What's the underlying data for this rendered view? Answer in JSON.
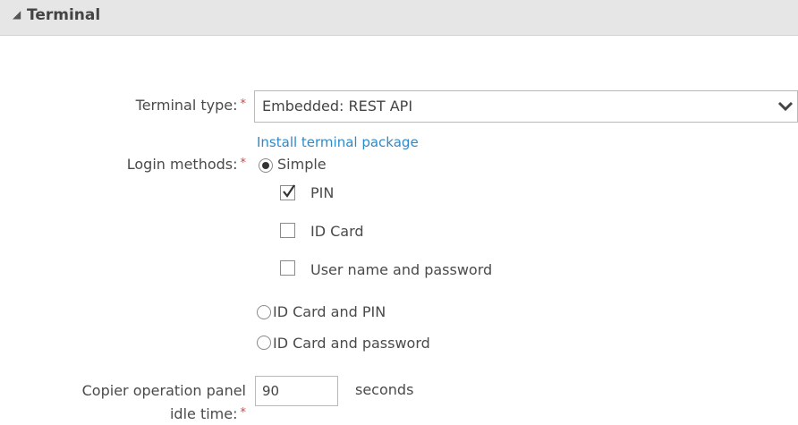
{
  "section": {
    "title": "Terminal",
    "icon": "collapse-triangle-icon"
  },
  "terminal_type": {
    "label": "Terminal type:",
    "required_mark": "*",
    "value": "Embedded: REST API",
    "icon": "chevron-down-icon"
  },
  "install_link": "Install terminal package",
  "login_methods": {
    "label": "Login methods:",
    "required_mark": "*",
    "options": [
      {
        "label": "Simple",
        "selected": true
      },
      {
        "label": "ID Card and PIN",
        "selected": false
      },
      {
        "label": "ID Card and password",
        "selected": false
      }
    ],
    "simple_suboptions": [
      {
        "label": "PIN",
        "checked": true
      },
      {
        "label": "ID Card",
        "checked": false
      },
      {
        "label": "User name and password",
        "checked": false
      }
    ]
  },
  "idle_time": {
    "label_line1": "Copier operation panel",
    "label_line2": "idle time:",
    "required_mark": "*",
    "value": "90",
    "unit": "seconds"
  },
  "colors": {
    "header_bg": "#e6e6e6",
    "link": "#2f8ac9",
    "required": "#e23c3c",
    "text": "#4a4a4a"
  }
}
